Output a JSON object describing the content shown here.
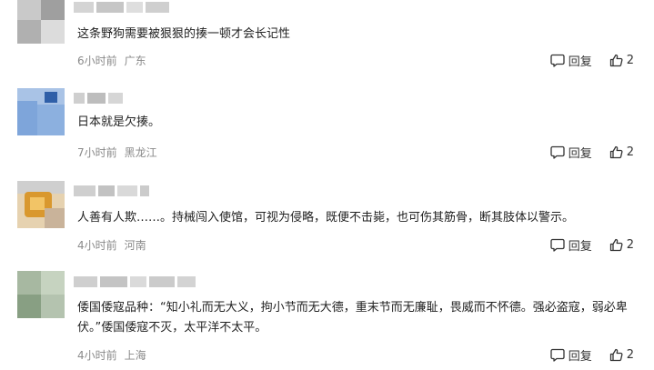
{
  "comments": [
    {
      "text": "这条野狗需要被狠狠的揍一顿才会长记性",
      "time": "6小时前",
      "location": "广东",
      "reply_label": "回复",
      "likes": "2",
      "colors": [
        "#c7c7c7",
        "#a8a8a8",
        "#dadada",
        "#b5b5b5"
      ]
    },
    {
      "text": "日本就是欠揍。",
      "time": "7小时前",
      "location": "黑龙江",
      "reply_label": "回复",
      "likes": "2",
      "colors": [
        "#7fa6d6",
        "#3e6fb3",
        "#b6cbe6",
        "#5f8fcc"
      ]
    },
    {
      "text": "人善有人欺……。持械闯入使馆，可视为侵略，既便不击毙，也可伤其筋骨，断其肢体以警示。",
      "time": "4小时前",
      "location": "河南",
      "reply_label": "回复",
      "likes": "2",
      "colors": [
        "#d9a441",
        "#b56f1f",
        "#f0cf86",
        "#8a5a2a"
      ]
    },
    {
      "text": "倭国倭寇品种：“知小礼而无大义，拘小节而无大德，重末节而无廉耻，畏威而不怀德。强必盗寇，弱必卑伏。”倭国倭寇不灭，太平洋不太平。",
      "time": "4小时前",
      "location": "上海",
      "reply_label": "回复",
      "likes": "2",
      "colors": [
        "#9fb39a",
        "#c9d6c2",
        "#7e9a7a",
        "#b8c6b4"
      ]
    }
  ]
}
